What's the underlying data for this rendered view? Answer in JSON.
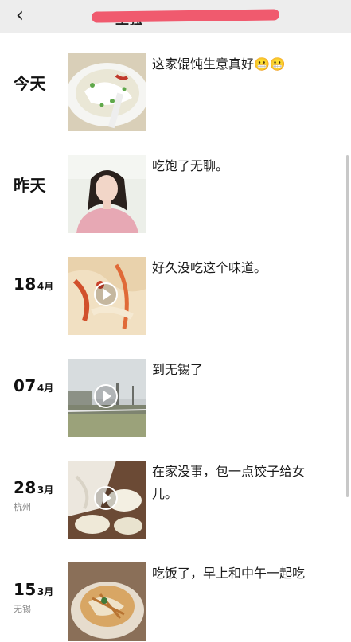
{
  "header": {
    "back_icon": "back-arrow-icon",
    "title": "王强"
  },
  "posts": [
    {
      "day": "今天",
      "month": "",
      "location": "",
      "text": "这家馄饨生意真好😬😬",
      "media": "photo-wonton-soup",
      "video": false
    },
    {
      "day": "昨天",
      "month": "",
      "location": "",
      "text": "吃饱了无聊。",
      "media": "photo-selfie",
      "video": false
    },
    {
      "day": "18",
      "month": "4月",
      "location": "",
      "text": "好久没吃这个味道。",
      "media": "video-noodles",
      "video": true
    },
    {
      "day": "07",
      "month": "4月",
      "location": "",
      "text": "到无锡了",
      "media": "video-street",
      "video": true
    },
    {
      "day": "28",
      "month": "3月",
      "location": "杭州",
      "text": "在家没事，包一点饺子给女儿。",
      "media": "video-dumplings",
      "video": true
    },
    {
      "day": "15",
      "month": "3月",
      "location": "无锡",
      "text": "吃饭了，早上和中午一起吃",
      "media": "photo-meal",
      "video": false
    }
  ],
  "colors": {
    "header_bg": "#ededed",
    "redaction": "#f05a6e",
    "location_text": "#8a8a8a"
  }
}
